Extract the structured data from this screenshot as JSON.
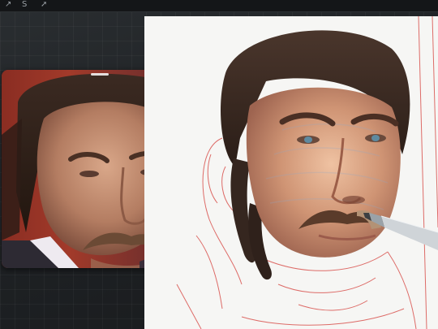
{
  "toolbar": {
    "tools": [
      {
        "glyph": "↗",
        "icon": "arrow-icon"
      },
      {
        "glyph": "S",
        "icon": "selection-icon"
      },
      {
        "glyph": "➚",
        "icon": "transform-icon"
      }
    ]
  },
  "reference_window": {
    "icon": "reference-photo"
  },
  "canvas": {
    "icon": "portrait-painting",
    "sketch_color": "#d9534f"
  },
  "stylus": {
    "icon": "apple-pencil-icon",
    "color": "#cfd4d8"
  }
}
